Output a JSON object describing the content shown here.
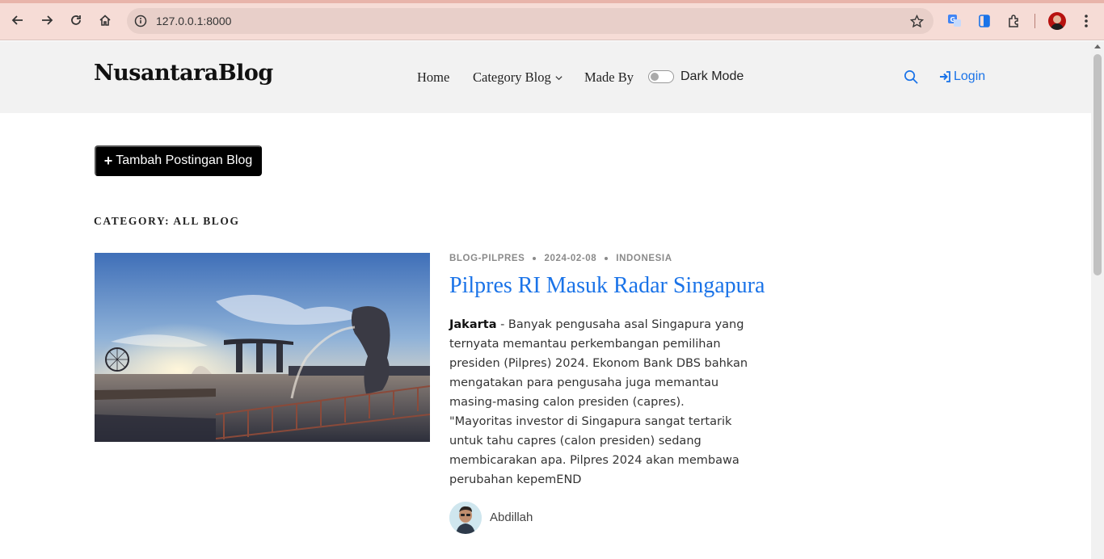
{
  "browser": {
    "url": "127.0.0.1:8000",
    "icons": [
      "back-icon",
      "forward-icon",
      "reload-icon",
      "home-icon",
      "site-info-icon",
      "bookmark-star-icon",
      "translate-icon",
      "reading-mode-icon",
      "extensions-icon",
      "profile-avatar",
      "more-menu-icon"
    ]
  },
  "header": {
    "logo": "NusantaraBlog",
    "nav": {
      "home": "Home",
      "category": "Category Blog",
      "made_by": "Made By"
    },
    "dark_mode_label": "Dark Mode",
    "login_label": "Login",
    "accent_color": "#1a73e8"
  },
  "main": {
    "add_post_label": "Tambah Postingan Blog",
    "category_heading": "CATEGORY: ALL BLOG",
    "post": {
      "tag": "BLOG-PILPRES",
      "date": "2024-02-08",
      "country": "INDONESIA",
      "title": "Pilpres RI Masuk Radar Singapura",
      "excerpt_lead": "Jakarta",
      "excerpt_body": " - Banyak pengusaha asal Singapura yang ternyata memantau perkembangan pemilihan presiden (Pilpres) 2024. Ekonom Bank DBS bahkan mengatakan para pengusaha juga memantau masing-masing calon presiden (capres).",
      "excerpt_quote": "\"Mayoritas investor di Singapura sangat tertarik untuk tahu capres (calon presiden) sedang membicarakan apa. Pilpres 2024 akan membawa perubahan kepemEND",
      "author": "Abdillah"
    }
  }
}
